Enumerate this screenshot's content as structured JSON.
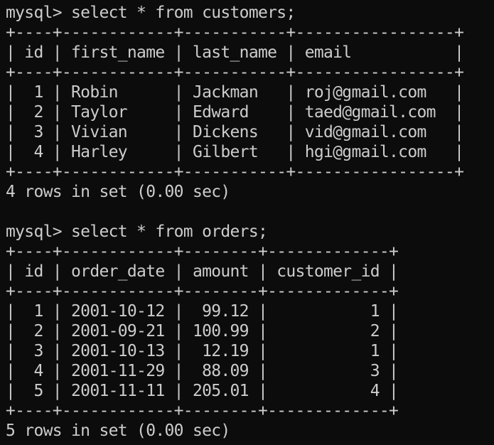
{
  "terminal": {
    "lines": [
      "mysql> select * from customers;",
      "+----+------------+-----------+-----------------+",
      "| id | first_name | last_name | email           |",
      "+----+------------+-----------+-----------------+",
      "|  1 | Robin      | Jackman   | roj@gmail.com   |",
      "|  2 | Taylor     | Edward    | taed@gmail.com  |",
      "|  3 | Vivian     | Dickens   | vid@gmail.com   |",
      "|  4 | Harley     | Gilbert   | hgi@gmail.com   |",
      "+----+------------+-----------+-----------------+",
      "4 rows in set (0.00 sec)",
      "",
      "mysql> select * from orders;",
      "+----+------------+--------+-------------+",
      "| id | order_date | amount | customer_id |",
      "+----+------------+--------+-------------+",
      "|  1 | 2001-10-12 |  99.12 |           1 |",
      "|  2 | 2001-09-21 | 100.99 |           2 |",
      "|  3 | 2001-10-13 |  12.19 |           1 |",
      "|  4 | 2001-11-29 |  88.09 |           3 |",
      "|  5 | 2001-11-11 | 205.01 |           4 |",
      "+----+------------+--------+-------------+",
      "5 rows in set (0.00 sec)"
    ]
  },
  "colors": {
    "background": "#0c0c0c",
    "text": "#cccccc"
  }
}
